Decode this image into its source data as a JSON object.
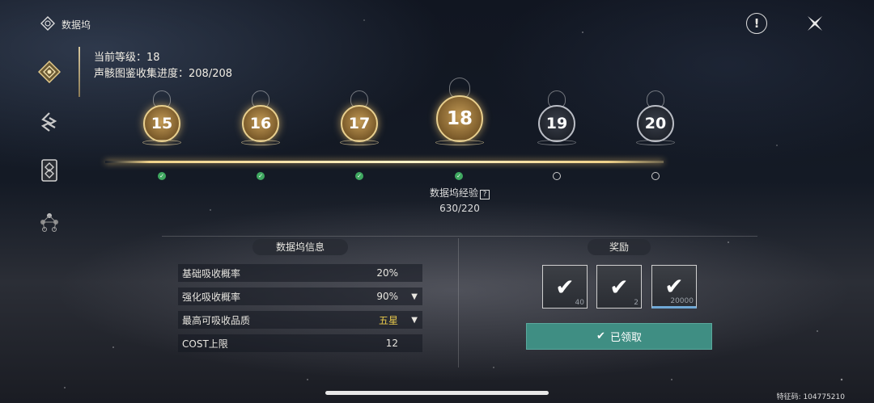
{
  "sidebar": {
    "title": "数据坞",
    "items": [
      {
        "icon": "data-dock-icon"
      },
      {
        "icon": "sonance-icon"
      },
      {
        "icon": "cards-icon"
      },
      {
        "icon": "nodes-icon"
      }
    ]
  },
  "header": {
    "warning_glyph": "!",
    "close_glyph": "✕"
  },
  "info": {
    "level_label": "当前等级：",
    "level_value": "18",
    "collection_label": "声骸图鉴收集进度：",
    "collection_value": "208/208"
  },
  "timeline": {
    "levels": [
      {
        "num": "15",
        "state": "done"
      },
      {
        "num": "16",
        "state": "done"
      },
      {
        "num": "17",
        "state": "done"
      },
      {
        "num": "18",
        "state": "current"
      },
      {
        "num": "19",
        "state": "locked"
      },
      {
        "num": "20",
        "state": "locked"
      }
    ],
    "exp_label": "数据坞经验",
    "exp_value": "630/220"
  },
  "dock_info": {
    "title": "数据坞信息",
    "rows": [
      {
        "label": "基础吸收概率",
        "value": "20%"
      },
      {
        "label": "强化吸收概率",
        "value": "90%"
      },
      {
        "label": "最高可吸收品质",
        "value": "五星"
      },
      {
        "label": "COST上限",
        "value": "12"
      }
    ]
  },
  "rewards": {
    "title": "奖励",
    "items": [
      {
        "count": "40"
      },
      {
        "count": "2"
      },
      {
        "count": "20000"
      }
    ],
    "claim_label": "已领取"
  },
  "footer": {
    "code": "特征码: 104775210"
  },
  "colors": {
    "accent_gold": "#e8cf8e",
    "claim_green": "#3f8e83",
    "check_green": "#3fa860"
  }
}
